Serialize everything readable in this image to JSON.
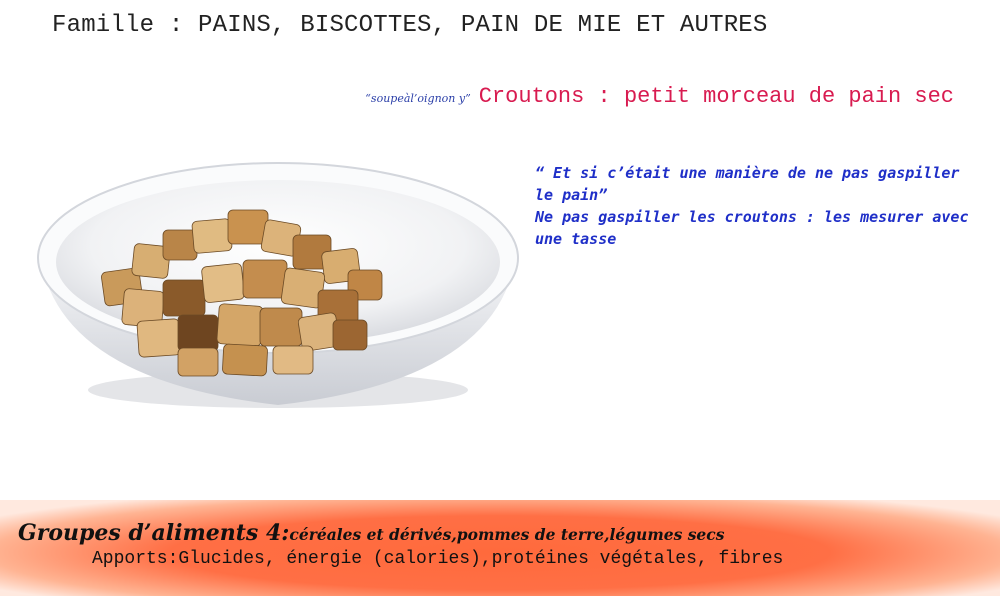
{
  "header": {
    "famille": "Famille : PAINS, BISCOTTES, PAIN DE MIE ET AUTRES"
  },
  "subtitle": {
    "note": "“soupeàl’oignon y”",
    "title": "Croutons : petit morceau de pain sec"
  },
  "quote": {
    "line1": "“ Et si c’était une manière de ne pas gaspiller le pain”",
    "line2": "Ne pas gaspiller les croutons : les mesurer avec une tasse"
  },
  "photo": {
    "icon": "bowl-of-croutons-image"
  },
  "footer": {
    "groupes_head": "Groupes d’aliments 4:",
    "groupes_desc": "céréales et dérivés,pommes de terre,légumes secs",
    "apports": "Apports:Glucides, énergie (calories),protéines végétales, fibres",
    "background_color": "#ff6a3c"
  }
}
